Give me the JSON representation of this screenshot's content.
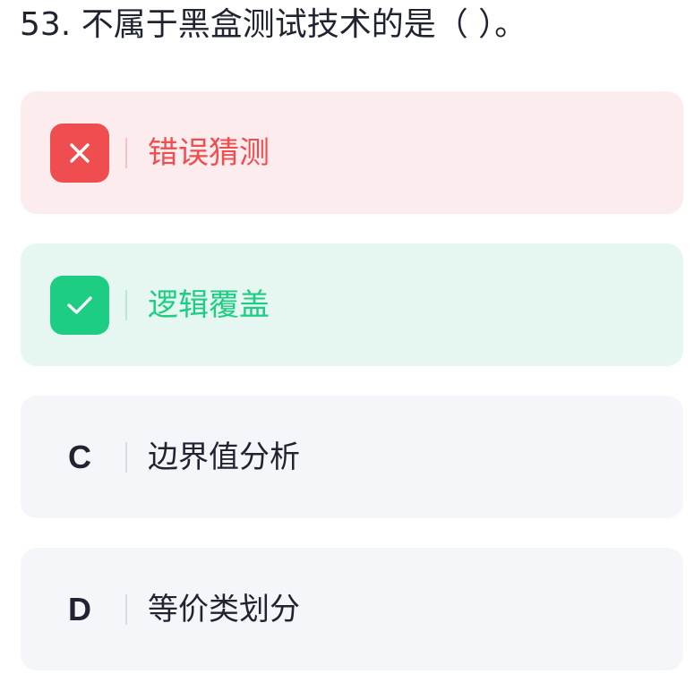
{
  "question": {
    "text": "53. 不属于黑盒测试技术的是（ ）。"
  },
  "options": [
    {
      "state": "wrong",
      "icon": "close-icon",
      "text": "错误猜测"
    },
    {
      "state": "correct",
      "icon": "check-icon",
      "text": "逻辑覆盖"
    },
    {
      "state": "normal",
      "letter": "C",
      "text": "边界值分析"
    },
    {
      "state": "normal",
      "letter": "D",
      "text": "等价类划分"
    }
  ],
  "colors": {
    "wrong": "#ef4d4f",
    "wrong_bg": "#fdeced",
    "correct": "#1ccd83",
    "correct_bg": "#e6f7f1",
    "normal_bg": "#f5f6fa",
    "text": "#1f2430"
  }
}
